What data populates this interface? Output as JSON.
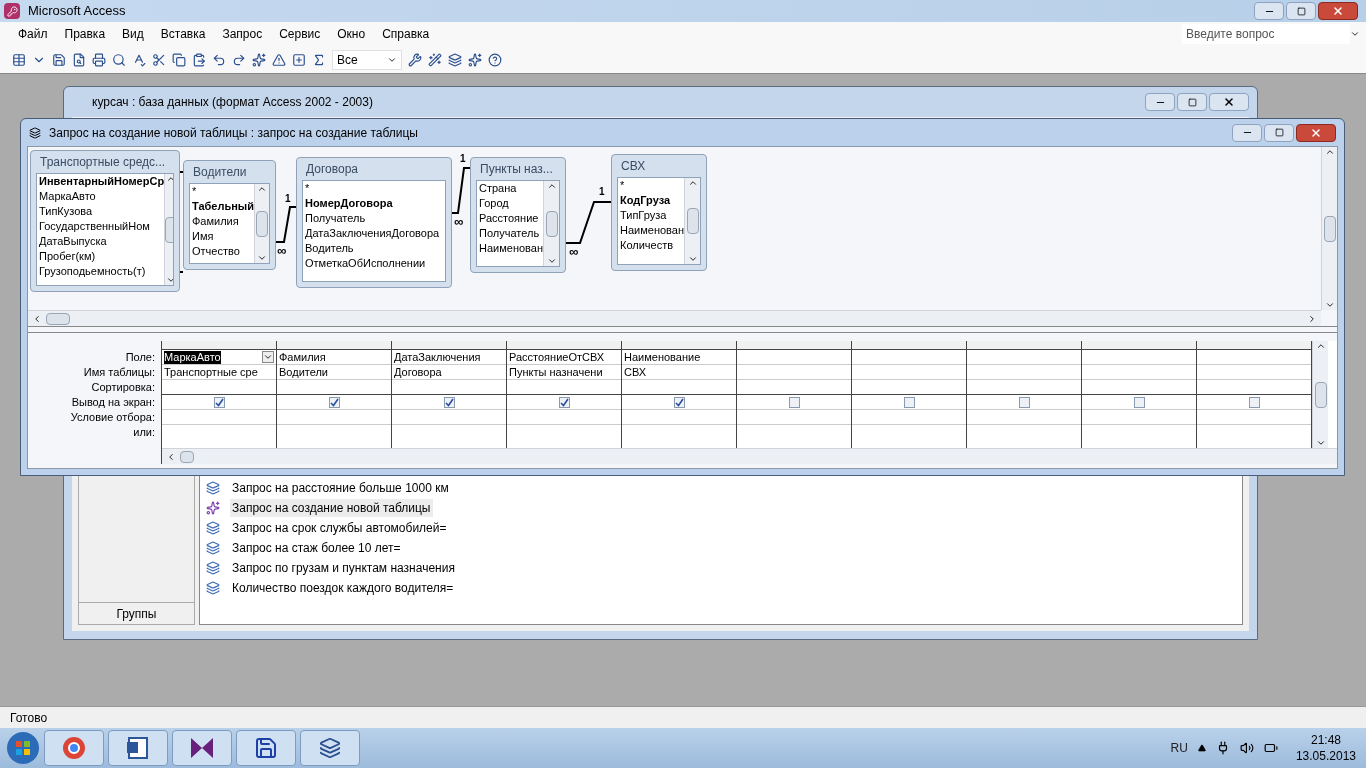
{
  "app": {
    "title": "Microsoft Access",
    "menu": [
      "Файл",
      "Правка",
      "Вид",
      "Вставка",
      "Запрос",
      "Сервис",
      "Окно",
      "Справка"
    ],
    "help_search": {
      "placeholder": "Введите вопрос"
    },
    "toolbar_combo": "Все"
  },
  "database_window": {
    "title": "курсач : база данных (формат Access 2002 - 2003)",
    "groups_button": "Группы",
    "objects": [
      {
        "label": "Запрос на расстояние больше 1000 км",
        "kind": "select",
        "selected": false
      },
      {
        "label": "Запрос на создание новой таблицы",
        "kind": "make_table",
        "selected": true
      },
      {
        "label": "Запрос на срок службы автомобилей=",
        "kind": "select",
        "selected": false
      },
      {
        "label": "Запрос на стаж более 10 лет=",
        "kind": "select",
        "selected": false
      },
      {
        "label": "Запрос по грузам и пунктам назначения",
        "kind": "select",
        "selected": false
      },
      {
        "label": "Количество поездок каждого водителя=",
        "kind": "select",
        "selected": false
      }
    ]
  },
  "query_window": {
    "title": "Запрос на создание новой таблицы : запрос на создание таблицы",
    "tables": [
      {
        "title": "Транспортные средс...",
        "fields": [
          {
            "name": "ИнвентарныйНомерСр",
            "key": true
          },
          {
            "name": "МаркаАвто",
            "key": false
          },
          {
            "name": "ТипКузова",
            "key": false
          },
          {
            "name": "ГосударственныйНом",
            "key": false
          },
          {
            "name": "ДатаВыпуска",
            "key": false
          },
          {
            "name": "Пробег(км)",
            "key": false
          },
          {
            "name": "Грузоподьемность(т)",
            "key": false
          }
        ]
      },
      {
        "title": "Водители",
        "fields": [
          {
            "name": "*",
            "key": false
          },
          {
            "name": "Табельный",
            "key": true
          },
          {
            "name": "Фамилия",
            "key": false
          },
          {
            "name": "Имя",
            "key": false
          },
          {
            "name": "Отчество",
            "key": false
          }
        ]
      },
      {
        "title": "Договора",
        "fields": [
          {
            "name": "*",
            "key": false
          },
          {
            "name": "НомерДоговора",
            "key": true
          },
          {
            "name": "Получатель",
            "key": false
          },
          {
            "name": "ДатаЗаключенияДоговора",
            "key": false
          },
          {
            "name": "Водитель",
            "key": false
          },
          {
            "name": "ОтметкаОбИсполнении",
            "key": false
          }
        ]
      },
      {
        "title": "Пункты наз...",
        "fields": [
          {
            "name": "Страна",
            "key": false
          },
          {
            "name": "Город",
            "key": false
          },
          {
            "name": "Расстояние",
            "key": false
          },
          {
            "name": "Получатель",
            "key": false
          },
          {
            "name": "Наименован",
            "key": false
          }
        ]
      },
      {
        "title": "СВХ",
        "fields": [
          {
            "name": "*",
            "key": false
          },
          {
            "name": "КодГруза",
            "key": true
          },
          {
            "name": "ТипГруза",
            "key": false
          },
          {
            "name": "Наименован",
            "key": false
          },
          {
            "name": "Количеств",
            "key": false
          }
        ]
      }
    ],
    "relations": [
      {
        "one": "1",
        "many": "∞"
      },
      {
        "one": "1",
        "many": "∞"
      },
      {
        "one": "1",
        "many": "∞"
      }
    ],
    "row_labels": [
      "Поле:",
      "Имя таблицы:",
      "Сортировка:",
      "Вывод на экран:",
      "Условие отбора:",
      "или:"
    ],
    "columns": [
      {
        "field": "МаркаАвто",
        "table": "Транспортные сре",
        "show": true,
        "selected": true
      },
      {
        "field": "Фамилия",
        "table": "Водители",
        "show": true,
        "selected": false
      },
      {
        "field": "ДатаЗаключения",
        "table": "Договора",
        "show": true,
        "selected": false
      },
      {
        "field": "РасстояниеОтСВХ",
        "table": "Пункты назначени",
        "show": true,
        "selected": false
      },
      {
        "field": "Наименование",
        "table": "СВХ",
        "show": true,
        "selected": false
      },
      {
        "show": false,
        "selected": false
      },
      {
        "show": false,
        "selected": false
      },
      {
        "show": false,
        "selected": false
      },
      {
        "show": false,
        "selected": false
      },
      {
        "show": false,
        "selected": false
      }
    ]
  },
  "status_bar": "Готово",
  "taskbar": {
    "language": "RU",
    "time": "21:48",
    "date": "13.05.2013"
  }
}
